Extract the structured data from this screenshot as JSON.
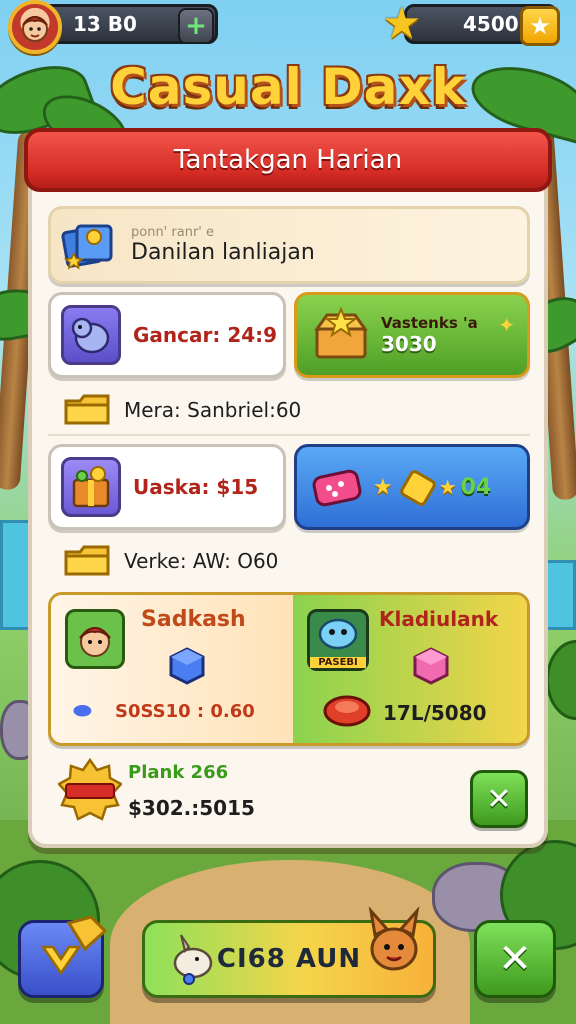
{
  "hud": {
    "coins_value": "13 B0",
    "plus_icon": "plus-icon",
    "stars_value": "4500",
    "star_icon": "star-icon"
  },
  "game_title": "Casual Daxk",
  "panel": {
    "header": "Tantakgan Harian",
    "banner": {
      "subtitle": "ponn' ranr' e",
      "title": "Danilan lanliajan"
    },
    "card_a_left": {
      "label": "Gancar: 24:9"
    },
    "card_a_right": {
      "label": "Vastenks 'a",
      "value": "3030"
    },
    "row_1": {
      "label": "Mera: Sanbriel:60"
    },
    "card_b_left": {
      "label": "Uaska: $15"
    },
    "card_b_right": {
      "badge": "04"
    },
    "row_2": {
      "label": "Verke: AW: O60"
    },
    "dual": {
      "left_name": "Sadkash",
      "left_value": "S0SS10 : 0.60",
      "right_name": "Kladiulank",
      "right_tag": "PASEBI",
      "right_value": "17L/5080"
    },
    "reward": {
      "title": "Plank 266",
      "value": "$302.:5015"
    }
  },
  "bottom": {
    "main_label": "CI68 AUN"
  },
  "colors": {
    "accent_red": "#d62d26",
    "accent_green": "#5fb82f",
    "accent_blue": "#2f7fe0",
    "gold": "#f7c520"
  }
}
